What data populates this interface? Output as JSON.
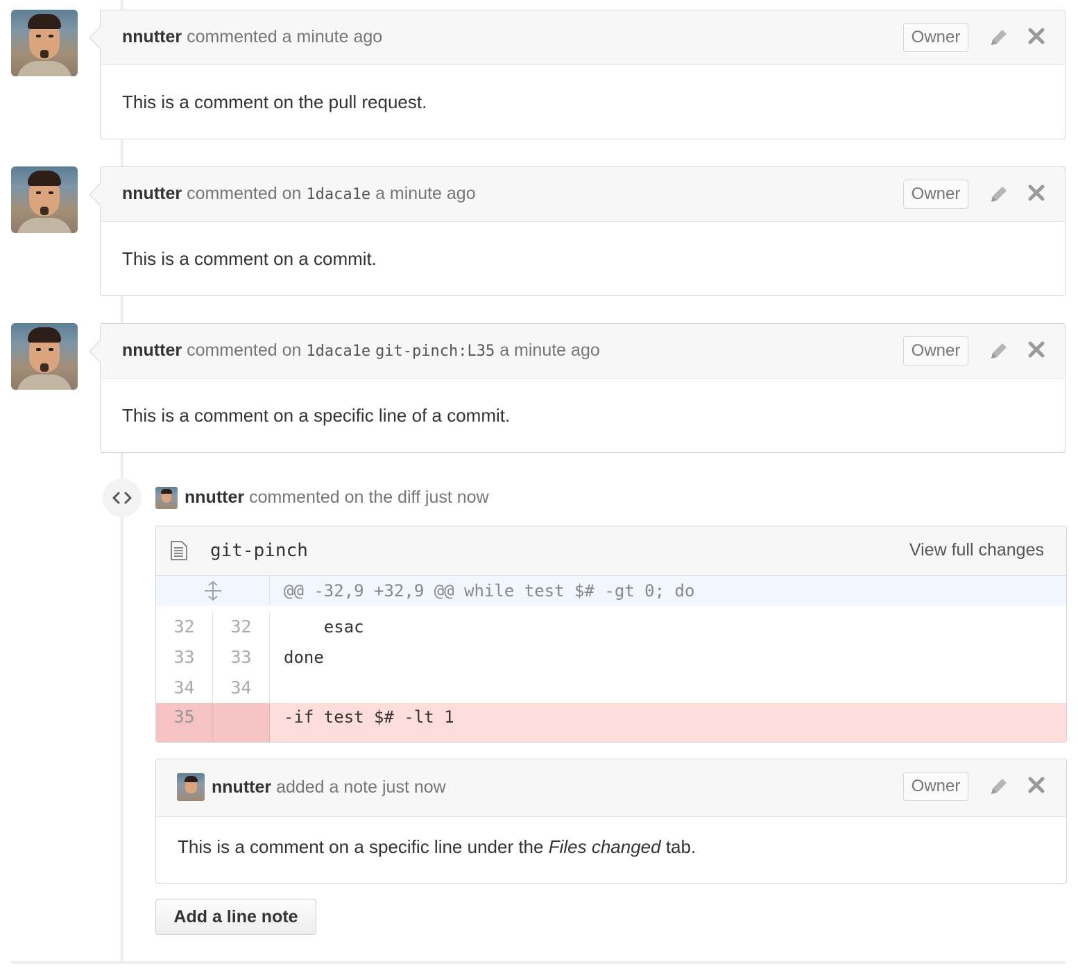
{
  "comments": [
    {
      "author": "nnutter",
      "action": "commented",
      "commit": "",
      "location": "",
      "time": "a minute ago",
      "badge": "Owner",
      "body": "This is a comment on the pull request."
    },
    {
      "author": "nnutter",
      "action": "commented on",
      "commit": "1daca1e",
      "location": "",
      "time": "a minute ago",
      "badge": "Owner",
      "body": "This is a comment on a commit."
    },
    {
      "author": "nnutter",
      "action": "commented on",
      "commit": "1daca1e",
      "location": "git-pinch:L35",
      "time": "a minute ago",
      "badge": "Owner",
      "body": "This is a comment on a specific line of a commit."
    }
  ],
  "diff_event": {
    "author": "nnutter",
    "text": "commented on the diff just now",
    "icon": "code-icon"
  },
  "file": {
    "name": "git-pinch",
    "view_full_label": "View full changes",
    "hunk_header": "@@ -32,9 +32,9 @@ while test $# -gt 0; do",
    "lines": [
      {
        "old": "32",
        "new": "32",
        "code": "    esac",
        "type": "context"
      },
      {
        "old": "33",
        "new": "33",
        "code": "done",
        "type": "context"
      },
      {
        "old": "34",
        "new": "34",
        "code": "",
        "type": "context"
      },
      {
        "old": "35",
        "new": "",
        "code": "-if test $# -lt 1",
        "type": "deleted"
      }
    ]
  },
  "note": {
    "author": "nnutter",
    "text": "added a note just now",
    "badge": "Owner",
    "body_before": "This is a comment on a specific line under the ",
    "body_emphasis": "Files changed",
    "body_after": " tab."
  },
  "add_line_note_label": "Add a line note",
  "colors": {
    "deleted_line_bg": "#ffdddd",
    "deleted_gutter_bg": "#f5c3c3",
    "hunk_bg": "#f2f6fe",
    "header_bg": "#f7f7f7",
    "border": "#d6d6d6"
  }
}
